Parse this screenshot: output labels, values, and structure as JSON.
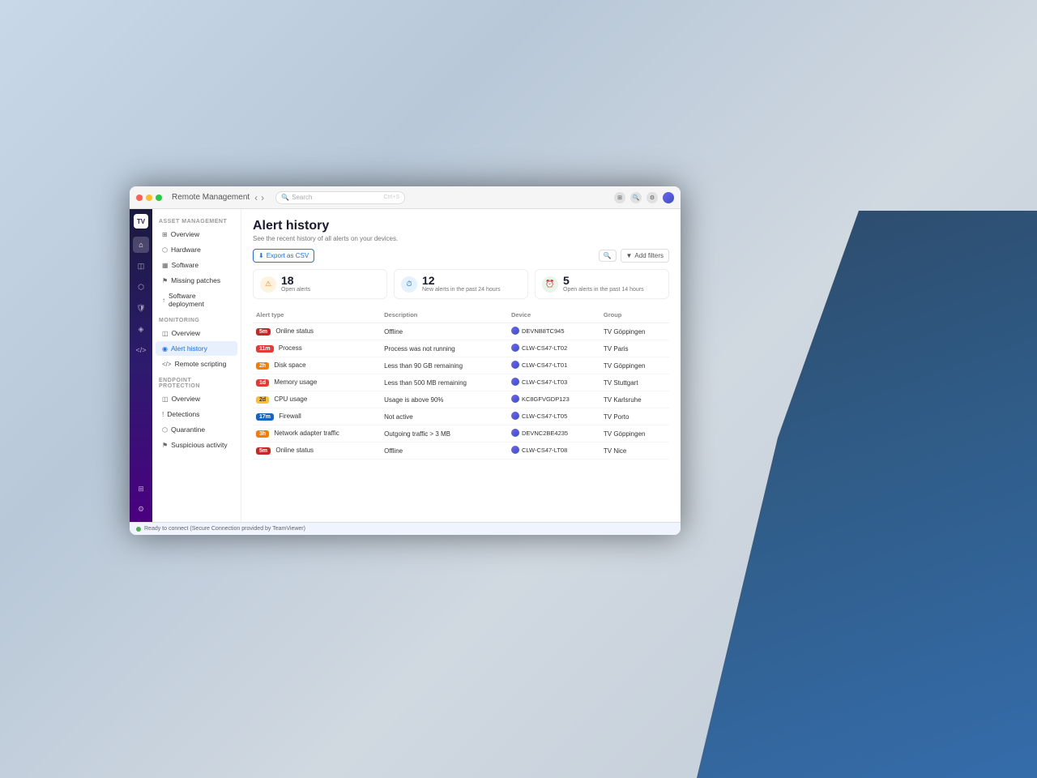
{
  "app": {
    "title": "Remote Management",
    "status": "Ready to connect (Secure Connection provided by TeamViewer)"
  },
  "search": {
    "placeholder": "Search",
    "shortcut": "Ctrl+S"
  },
  "sidebar": {
    "asset_management": {
      "title": "ASSET MANAGEMENT",
      "items": [
        {
          "id": "overview",
          "label": "Overview",
          "icon": "⊞"
        },
        {
          "id": "hardware",
          "label": "Hardware",
          "icon": "⬡"
        },
        {
          "id": "software",
          "label": "Software",
          "icon": "▦"
        },
        {
          "id": "missing-patches",
          "label": "Missing patches",
          "icon": "⚑"
        },
        {
          "id": "software-deployment",
          "label": "Software deployment",
          "icon": "↑"
        }
      ]
    },
    "monitoring": {
      "title": "MONITORING",
      "items": [
        {
          "id": "mon-overview",
          "label": "Overview",
          "icon": "◫"
        },
        {
          "id": "alert-history",
          "label": "Alert history",
          "icon": "◉",
          "active": true
        },
        {
          "id": "remote-scripting",
          "label": "Remote scripting",
          "icon": "</>"
        }
      ]
    },
    "endpoint_protection": {
      "title": "ENDPOINT PROTECTION",
      "items": [
        {
          "id": "ep-overview",
          "label": "Overview",
          "icon": "◫"
        },
        {
          "id": "detections",
          "label": "Detections",
          "icon": "!"
        },
        {
          "id": "quarantine",
          "label": "Quarantine",
          "icon": "⬡"
        },
        {
          "id": "suspicious-activity",
          "label": "Suspicious activity",
          "icon": "⚑"
        }
      ]
    }
  },
  "page": {
    "title": "Alert history",
    "subtitle": "See the recent history of all alerts on your devices."
  },
  "toolbar": {
    "export_label": "Export as CSV",
    "add_filters_label": "Add filters"
  },
  "stats": [
    {
      "id": "open-alerts",
      "value": "18",
      "label": "Open alerts",
      "icon": "⚠",
      "type": "warning"
    },
    {
      "id": "new-alerts-24h",
      "value": "12",
      "label": "New alerts in the past 24 hours",
      "icon": "⏱",
      "type": "info"
    },
    {
      "id": "open-alerts-24h",
      "value": "5",
      "label": "Open alerts in the past 14 hours",
      "icon": "⏰",
      "type": "success"
    }
  ],
  "table": {
    "columns": [
      "Alert type",
      "Description",
      "Device",
      "Group"
    ],
    "rows": [
      {
        "severity": "5m",
        "sev_class": "sev-critical",
        "type": "Online status",
        "description": "Offline",
        "device": "DEVNB8TC945",
        "group": "TV Göppingen"
      },
      {
        "severity": "11m",
        "sev_class": "sev-high",
        "type": "Process",
        "description": "Process was not running",
        "device": "CLW-CS47-LT02",
        "group": "TV Paris"
      },
      {
        "severity": "2h",
        "sev_class": "sev-medium",
        "type": "Disk space",
        "description": "Less than 90 GB remaining",
        "device": "CLW-CS47-LT01",
        "group": "TV Göppingen"
      },
      {
        "severity": "1d",
        "sev_class": "sev-high",
        "type": "Memory usage",
        "description": "Less than 500 MB remaining",
        "device": "CLW-CS47-LT03",
        "group": "TV Stuttgart"
      },
      {
        "severity": "2d",
        "sev_class": "sev-low",
        "type": "CPU usage",
        "description": "Usage is above 90%",
        "device": "KC8GFVGDP123",
        "group": "TV Karlsruhe"
      },
      {
        "severity": "17m",
        "sev_class": "sev-info",
        "type": "Firewall",
        "description": "Not active",
        "device": "CLW-CS47-LT05",
        "group": "TV Porto"
      },
      {
        "severity": "3h",
        "sev_class": "sev-medium",
        "type": "Network adapter traffic",
        "description": "Outgoing traffic > 3 MB",
        "device": "DEVNC2BE4235",
        "group": "TV Göppingen"
      },
      {
        "severity": "5m",
        "sev_class": "sev-critical",
        "type": "Online status",
        "description": "Offline",
        "device": "CLW-CS47-LT08",
        "group": "TV Nice"
      }
    ]
  }
}
